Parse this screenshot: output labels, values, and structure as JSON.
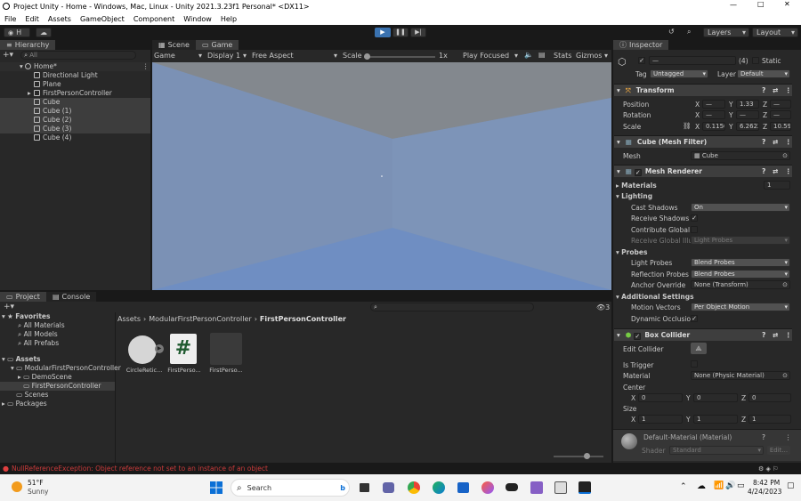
{
  "window": {
    "title": "Project Unity - Home - Windows, Mac, Linux - Unity 2021.3.23f1 Personal* <DX11>"
  },
  "menu": [
    "File",
    "Edit",
    "Assets",
    "GameObject",
    "Component",
    "Window",
    "Help"
  ],
  "toolbar": {
    "account": "H",
    "layers": "Layers",
    "layout": "Layout"
  },
  "hierarchy": {
    "tab": "Hierarchy",
    "search_placeholder": "All",
    "items": [
      {
        "label": "Home*"
      },
      {
        "label": "Directional Light"
      },
      {
        "label": "Plane"
      },
      {
        "label": "FirstPersonController"
      },
      {
        "label": "Cube"
      },
      {
        "label": "Cube (1)"
      },
      {
        "label": "Cube (2)"
      },
      {
        "label": "Cube (3)"
      },
      {
        "label": "Cube (4)"
      }
    ]
  },
  "viewtabs": {
    "scene": "Scene",
    "game": "Game"
  },
  "gamebar": {
    "mode": "Game",
    "display": "Display 1",
    "aspect": "Free Aspect",
    "scale_label": "Scale",
    "scale_value": "1x",
    "play_focused": "Play Focused",
    "stats": "Stats",
    "gizmos": "Gizmos"
  },
  "project": {
    "tab_project": "Project",
    "tab_console": "Console",
    "favorites": "Favorites",
    "fav_items": [
      "All Materials",
      "All Models",
      "All Prefabs"
    ],
    "assets": "Assets",
    "asset_tree": [
      "ModularFirstPersonController",
      "DemoScene",
      "FirstPersonController",
      "Scenes",
      "Packages"
    ],
    "breadcrumb": [
      "Assets",
      "ModularFirstPersonController",
      "FirstPersonController"
    ],
    "files": [
      "CircleRetic...",
      "FirstPerso...",
      "FirstPerso..."
    ],
    "count": "3"
  },
  "inspector": {
    "tab": "Inspector",
    "count": "(4)",
    "static": "Static",
    "tag_label": "Tag",
    "tag": "Untagged",
    "layer_label": "Layer",
    "layer": "Default",
    "transform": {
      "title": "Transform",
      "position": "Position",
      "rotation": "Rotation",
      "scale": "Scale",
      "pos": [
        "—",
        "1.33",
        "—"
      ],
      "rot": [
        "—",
        "—",
        "—"
      ],
      "scl": [
        "0.1150",
        "6.2622",
        "10.59"
      ]
    },
    "mesh_filter": {
      "title": "Cube (Mesh Filter)",
      "mesh_label": "Mesh",
      "mesh": "Cube"
    },
    "mesh_renderer": {
      "title": "Mesh Renderer",
      "materials": "Materials",
      "materials_count": "1",
      "lighting": "Lighting",
      "cast_shadows": "Cast Shadows",
      "cast_shadows_val": "On",
      "receive_shadows": "Receive Shadows",
      "contribute_gi": "Contribute Global I",
      "receive_gi": "Receive Global Illu",
      "receive_gi_val": "Light Probes",
      "probes": "Probes",
      "light_probes": "Light Probes",
      "light_probes_val": "Blend Probes",
      "reflection_probes": "Reflection Probes",
      "reflection_probes_val": "Blend Probes",
      "anchor_override": "Anchor Override",
      "anchor_override_val": "None (Transform)",
      "additional": "Additional Settings",
      "motion_vectors": "Motion Vectors",
      "motion_vectors_val": "Per Object Motion",
      "dynamic_occlusion": "Dynamic Occlusio"
    },
    "box_collider": {
      "title": "Box Collider",
      "edit_collider": "Edit Collider",
      "is_trigger": "Is Trigger",
      "material": "Material",
      "material_val": "None (Physic Material)",
      "center": "Center",
      "center_vals": [
        "0",
        "0",
        "0"
      ],
      "size": "Size",
      "size_vals": [
        "1",
        "1",
        "1"
      ]
    },
    "material": {
      "title": "Default-Material (Material)",
      "shader_label": "Shader",
      "shader": "Standard",
      "edit": "Edit..."
    }
  },
  "status": {
    "error": "NullReferenceException: Object reference not set to an instance of an object"
  },
  "taskbar": {
    "temp": "51°F",
    "weather": "Sunny",
    "search": "Search",
    "time": "8:42 PM",
    "date": "4/24/2023"
  }
}
